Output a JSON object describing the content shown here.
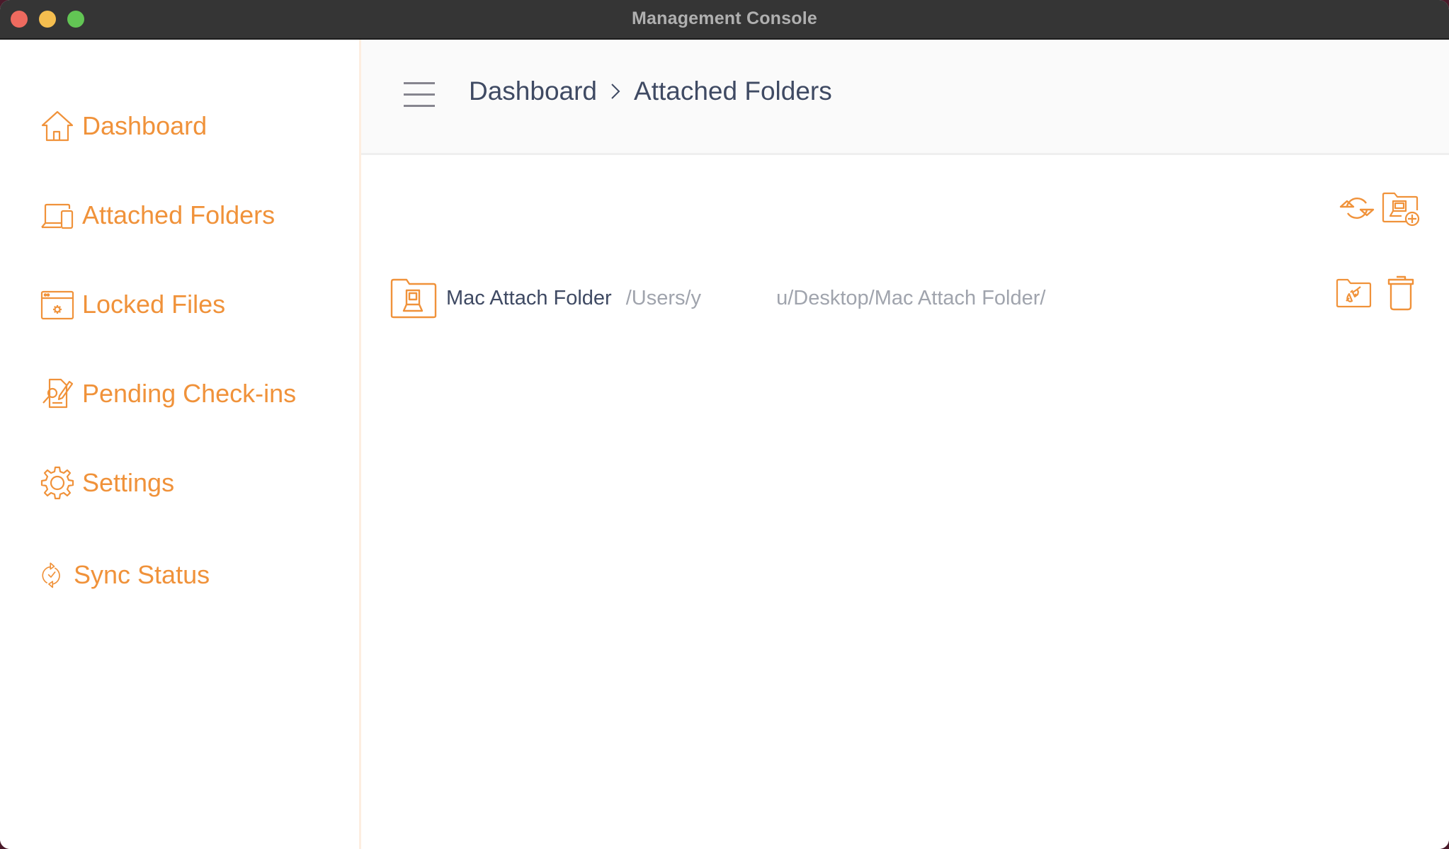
{
  "window": {
    "title": "Management Console",
    "traffic_lights": [
      "close",
      "minimize",
      "zoom"
    ]
  },
  "colors": {
    "accent": "#f0923a",
    "text_primary": "#3f4a63",
    "text_muted": "#a0a4ad",
    "titlebar": "#353535"
  },
  "sidebar": {
    "items": [
      {
        "label": "Dashboard",
        "icon": "house-icon"
      },
      {
        "label": "Attached Folders",
        "icon": "laptop-tablet-icon"
      },
      {
        "label": "Locked Files",
        "icon": "browser-gear-icon"
      },
      {
        "label": "Pending Check-ins",
        "icon": "document-search-edit-icon"
      },
      {
        "label": "Settings",
        "icon": "gear-icon"
      },
      {
        "label": "Sync Status",
        "icon": "sync-check-icon"
      }
    ]
  },
  "header": {
    "menu_icon": "hamburger-icon",
    "breadcrumb": [
      "Dashboard",
      "Attached Folders"
    ]
  },
  "toolbar": {
    "buttons": [
      {
        "name": "refresh",
        "icon": "refresh-icon"
      },
      {
        "name": "add-folder",
        "icon": "folder-add-icon"
      }
    ]
  },
  "folders": [
    {
      "name": "Mac Attach Folder",
      "path_start": "/Users/y",
      "path_end": "u/Desktop/Mac Attach Folder/",
      "actions": [
        {
          "name": "detach",
          "icon": "folder-plug-icon"
        },
        {
          "name": "delete",
          "icon": "trash-icon"
        }
      ]
    }
  ]
}
